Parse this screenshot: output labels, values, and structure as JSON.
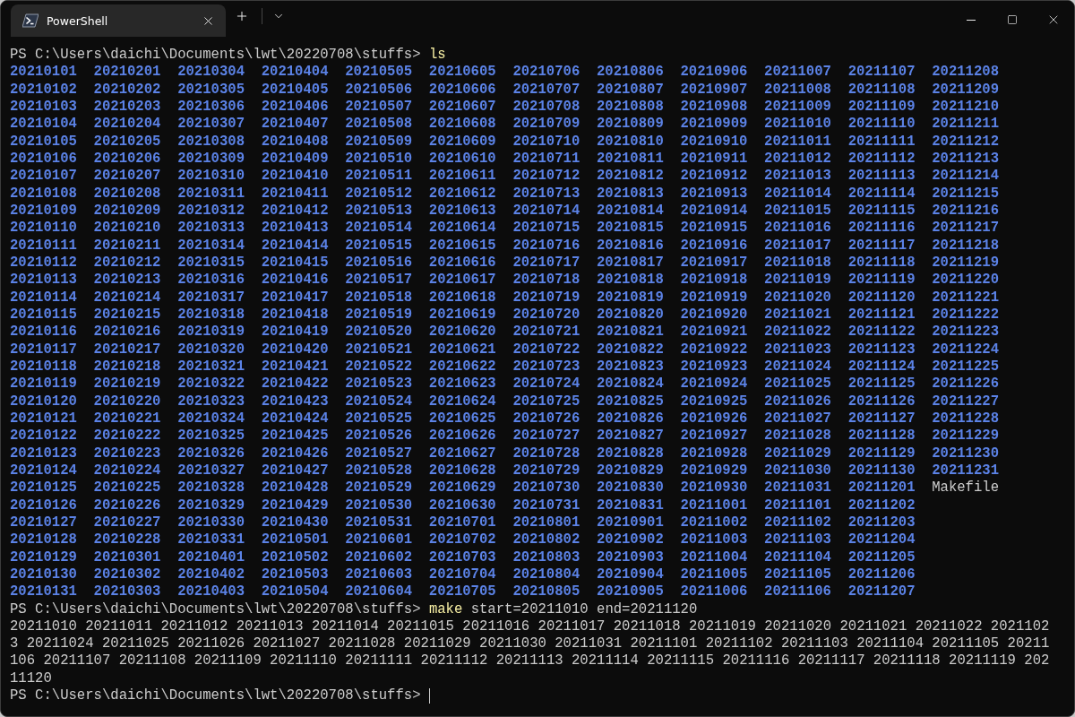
{
  "window": {
    "tab_title": "PowerShell"
  },
  "terminal": {
    "blocks": [
      {
        "kind": "command",
        "prompt": "PS C:\\Users\\daichi\\Documents\\lwt\\20220708\\stuffs>",
        "command": "ls",
        "cursor": false
      },
      {
        "kind": "listing",
        "rows": [
          [
            {
              "name": "20210101",
              "kind": "dir"
            },
            {
              "name": "20210201",
              "kind": "dir"
            },
            {
              "name": "20210304",
              "kind": "dir"
            },
            {
              "name": "20210404",
              "kind": "dir"
            },
            {
              "name": "20210505",
              "kind": "dir"
            },
            {
              "name": "20210605",
              "kind": "dir"
            },
            {
              "name": "20210706",
              "kind": "dir"
            },
            {
              "name": "20210806",
              "kind": "dir"
            },
            {
              "name": "20210906",
              "kind": "dir"
            },
            {
              "name": "20211007",
              "kind": "dir"
            },
            {
              "name": "20211107",
              "kind": "dir"
            },
            {
              "name": "20211208",
              "kind": "dir"
            }
          ],
          [
            {
              "name": "20210102",
              "kind": "dir"
            },
            {
              "name": "20210202",
              "kind": "dir"
            },
            {
              "name": "20210305",
              "kind": "dir"
            },
            {
              "name": "20210405",
              "kind": "dir"
            },
            {
              "name": "20210506",
              "kind": "dir"
            },
            {
              "name": "20210606",
              "kind": "dir"
            },
            {
              "name": "20210707",
              "kind": "dir"
            },
            {
              "name": "20210807",
              "kind": "dir"
            },
            {
              "name": "20210907",
              "kind": "dir"
            },
            {
              "name": "20211008",
              "kind": "dir"
            },
            {
              "name": "20211108",
              "kind": "dir"
            },
            {
              "name": "20211209",
              "kind": "dir"
            }
          ],
          [
            {
              "name": "20210103",
              "kind": "dir"
            },
            {
              "name": "20210203",
              "kind": "dir"
            },
            {
              "name": "20210306",
              "kind": "dir"
            },
            {
              "name": "20210406",
              "kind": "dir"
            },
            {
              "name": "20210507",
              "kind": "dir"
            },
            {
              "name": "20210607",
              "kind": "dir"
            },
            {
              "name": "20210708",
              "kind": "dir"
            },
            {
              "name": "20210808",
              "kind": "dir"
            },
            {
              "name": "20210908",
              "kind": "dir"
            },
            {
              "name": "20211009",
              "kind": "dir"
            },
            {
              "name": "20211109",
              "kind": "dir"
            },
            {
              "name": "20211210",
              "kind": "dir"
            }
          ],
          [
            {
              "name": "20210104",
              "kind": "dir"
            },
            {
              "name": "20210204",
              "kind": "dir"
            },
            {
              "name": "20210307",
              "kind": "dir"
            },
            {
              "name": "20210407",
              "kind": "dir"
            },
            {
              "name": "20210508",
              "kind": "dir"
            },
            {
              "name": "20210608",
              "kind": "dir"
            },
            {
              "name": "20210709",
              "kind": "dir"
            },
            {
              "name": "20210809",
              "kind": "dir"
            },
            {
              "name": "20210909",
              "kind": "dir"
            },
            {
              "name": "20211010",
              "kind": "dir"
            },
            {
              "name": "20211110",
              "kind": "dir"
            },
            {
              "name": "20211211",
              "kind": "dir"
            }
          ],
          [
            {
              "name": "20210105",
              "kind": "dir"
            },
            {
              "name": "20210205",
              "kind": "dir"
            },
            {
              "name": "20210308",
              "kind": "dir"
            },
            {
              "name": "20210408",
              "kind": "dir"
            },
            {
              "name": "20210509",
              "kind": "dir"
            },
            {
              "name": "20210609",
              "kind": "dir"
            },
            {
              "name": "20210710",
              "kind": "dir"
            },
            {
              "name": "20210810",
              "kind": "dir"
            },
            {
              "name": "20210910",
              "kind": "dir"
            },
            {
              "name": "20211011",
              "kind": "dir"
            },
            {
              "name": "20211111",
              "kind": "dir"
            },
            {
              "name": "20211212",
              "kind": "dir"
            }
          ],
          [
            {
              "name": "20210106",
              "kind": "dir"
            },
            {
              "name": "20210206",
              "kind": "dir"
            },
            {
              "name": "20210309",
              "kind": "dir"
            },
            {
              "name": "20210409",
              "kind": "dir"
            },
            {
              "name": "20210510",
              "kind": "dir"
            },
            {
              "name": "20210610",
              "kind": "dir"
            },
            {
              "name": "20210711",
              "kind": "dir"
            },
            {
              "name": "20210811",
              "kind": "dir"
            },
            {
              "name": "20210911",
              "kind": "dir"
            },
            {
              "name": "20211012",
              "kind": "dir"
            },
            {
              "name": "20211112",
              "kind": "dir"
            },
            {
              "name": "20211213",
              "kind": "dir"
            }
          ],
          [
            {
              "name": "20210107",
              "kind": "dir"
            },
            {
              "name": "20210207",
              "kind": "dir"
            },
            {
              "name": "20210310",
              "kind": "dir"
            },
            {
              "name": "20210410",
              "kind": "dir"
            },
            {
              "name": "20210511",
              "kind": "dir"
            },
            {
              "name": "20210611",
              "kind": "dir"
            },
            {
              "name": "20210712",
              "kind": "dir"
            },
            {
              "name": "20210812",
              "kind": "dir"
            },
            {
              "name": "20210912",
              "kind": "dir"
            },
            {
              "name": "20211013",
              "kind": "dir"
            },
            {
              "name": "20211113",
              "kind": "dir"
            },
            {
              "name": "20211214",
              "kind": "dir"
            }
          ],
          [
            {
              "name": "20210108",
              "kind": "dir"
            },
            {
              "name": "20210208",
              "kind": "dir"
            },
            {
              "name": "20210311",
              "kind": "dir"
            },
            {
              "name": "20210411",
              "kind": "dir"
            },
            {
              "name": "20210512",
              "kind": "dir"
            },
            {
              "name": "20210612",
              "kind": "dir"
            },
            {
              "name": "20210713",
              "kind": "dir"
            },
            {
              "name": "20210813",
              "kind": "dir"
            },
            {
              "name": "20210913",
              "kind": "dir"
            },
            {
              "name": "20211014",
              "kind": "dir"
            },
            {
              "name": "20211114",
              "kind": "dir"
            },
            {
              "name": "20211215",
              "kind": "dir"
            }
          ],
          [
            {
              "name": "20210109",
              "kind": "dir"
            },
            {
              "name": "20210209",
              "kind": "dir"
            },
            {
              "name": "20210312",
              "kind": "dir"
            },
            {
              "name": "20210412",
              "kind": "dir"
            },
            {
              "name": "20210513",
              "kind": "dir"
            },
            {
              "name": "20210613",
              "kind": "dir"
            },
            {
              "name": "20210714",
              "kind": "dir"
            },
            {
              "name": "20210814",
              "kind": "dir"
            },
            {
              "name": "20210914",
              "kind": "dir"
            },
            {
              "name": "20211015",
              "kind": "dir"
            },
            {
              "name": "20211115",
              "kind": "dir"
            },
            {
              "name": "20211216",
              "kind": "dir"
            }
          ],
          [
            {
              "name": "20210110",
              "kind": "dir"
            },
            {
              "name": "20210210",
              "kind": "dir"
            },
            {
              "name": "20210313",
              "kind": "dir"
            },
            {
              "name": "20210413",
              "kind": "dir"
            },
            {
              "name": "20210514",
              "kind": "dir"
            },
            {
              "name": "20210614",
              "kind": "dir"
            },
            {
              "name": "20210715",
              "kind": "dir"
            },
            {
              "name": "20210815",
              "kind": "dir"
            },
            {
              "name": "20210915",
              "kind": "dir"
            },
            {
              "name": "20211016",
              "kind": "dir"
            },
            {
              "name": "20211116",
              "kind": "dir"
            },
            {
              "name": "20211217",
              "kind": "dir"
            }
          ],
          [
            {
              "name": "20210111",
              "kind": "dir"
            },
            {
              "name": "20210211",
              "kind": "dir"
            },
            {
              "name": "20210314",
              "kind": "dir"
            },
            {
              "name": "20210414",
              "kind": "dir"
            },
            {
              "name": "20210515",
              "kind": "dir"
            },
            {
              "name": "20210615",
              "kind": "dir"
            },
            {
              "name": "20210716",
              "kind": "dir"
            },
            {
              "name": "20210816",
              "kind": "dir"
            },
            {
              "name": "20210916",
              "kind": "dir"
            },
            {
              "name": "20211017",
              "kind": "dir"
            },
            {
              "name": "20211117",
              "kind": "dir"
            },
            {
              "name": "20211218",
              "kind": "dir"
            }
          ],
          [
            {
              "name": "20210112",
              "kind": "dir"
            },
            {
              "name": "20210212",
              "kind": "dir"
            },
            {
              "name": "20210315",
              "kind": "dir"
            },
            {
              "name": "20210415",
              "kind": "dir"
            },
            {
              "name": "20210516",
              "kind": "dir"
            },
            {
              "name": "20210616",
              "kind": "dir"
            },
            {
              "name": "20210717",
              "kind": "dir"
            },
            {
              "name": "20210817",
              "kind": "dir"
            },
            {
              "name": "20210917",
              "kind": "dir"
            },
            {
              "name": "20211018",
              "kind": "dir"
            },
            {
              "name": "20211118",
              "kind": "dir"
            },
            {
              "name": "20211219",
              "kind": "dir"
            }
          ],
          [
            {
              "name": "20210113",
              "kind": "dir"
            },
            {
              "name": "20210213",
              "kind": "dir"
            },
            {
              "name": "20210316",
              "kind": "dir"
            },
            {
              "name": "20210416",
              "kind": "dir"
            },
            {
              "name": "20210517",
              "kind": "dir"
            },
            {
              "name": "20210617",
              "kind": "dir"
            },
            {
              "name": "20210718",
              "kind": "dir"
            },
            {
              "name": "20210818",
              "kind": "dir"
            },
            {
              "name": "20210918",
              "kind": "dir"
            },
            {
              "name": "20211019",
              "kind": "dir"
            },
            {
              "name": "20211119",
              "kind": "dir"
            },
            {
              "name": "20211220",
              "kind": "dir"
            }
          ],
          [
            {
              "name": "20210114",
              "kind": "dir"
            },
            {
              "name": "20210214",
              "kind": "dir"
            },
            {
              "name": "20210317",
              "kind": "dir"
            },
            {
              "name": "20210417",
              "kind": "dir"
            },
            {
              "name": "20210518",
              "kind": "dir"
            },
            {
              "name": "20210618",
              "kind": "dir"
            },
            {
              "name": "20210719",
              "kind": "dir"
            },
            {
              "name": "20210819",
              "kind": "dir"
            },
            {
              "name": "20210919",
              "kind": "dir"
            },
            {
              "name": "20211020",
              "kind": "dir"
            },
            {
              "name": "20211120",
              "kind": "dir"
            },
            {
              "name": "20211221",
              "kind": "dir"
            }
          ],
          [
            {
              "name": "20210115",
              "kind": "dir"
            },
            {
              "name": "20210215",
              "kind": "dir"
            },
            {
              "name": "20210318",
              "kind": "dir"
            },
            {
              "name": "20210418",
              "kind": "dir"
            },
            {
              "name": "20210519",
              "kind": "dir"
            },
            {
              "name": "20210619",
              "kind": "dir"
            },
            {
              "name": "20210720",
              "kind": "dir"
            },
            {
              "name": "20210820",
              "kind": "dir"
            },
            {
              "name": "20210920",
              "kind": "dir"
            },
            {
              "name": "20211021",
              "kind": "dir"
            },
            {
              "name": "20211121",
              "kind": "dir"
            },
            {
              "name": "20211222",
              "kind": "dir"
            }
          ],
          [
            {
              "name": "20210116",
              "kind": "dir"
            },
            {
              "name": "20210216",
              "kind": "dir"
            },
            {
              "name": "20210319",
              "kind": "dir"
            },
            {
              "name": "20210419",
              "kind": "dir"
            },
            {
              "name": "20210520",
              "kind": "dir"
            },
            {
              "name": "20210620",
              "kind": "dir"
            },
            {
              "name": "20210721",
              "kind": "dir"
            },
            {
              "name": "20210821",
              "kind": "dir"
            },
            {
              "name": "20210921",
              "kind": "dir"
            },
            {
              "name": "20211022",
              "kind": "dir"
            },
            {
              "name": "20211122",
              "kind": "dir"
            },
            {
              "name": "20211223",
              "kind": "dir"
            }
          ],
          [
            {
              "name": "20210117",
              "kind": "dir"
            },
            {
              "name": "20210217",
              "kind": "dir"
            },
            {
              "name": "20210320",
              "kind": "dir"
            },
            {
              "name": "20210420",
              "kind": "dir"
            },
            {
              "name": "20210521",
              "kind": "dir"
            },
            {
              "name": "20210621",
              "kind": "dir"
            },
            {
              "name": "20210722",
              "kind": "dir"
            },
            {
              "name": "20210822",
              "kind": "dir"
            },
            {
              "name": "20210922",
              "kind": "dir"
            },
            {
              "name": "20211023",
              "kind": "dir"
            },
            {
              "name": "20211123",
              "kind": "dir"
            },
            {
              "name": "20211224",
              "kind": "dir"
            }
          ],
          [
            {
              "name": "20210118",
              "kind": "dir"
            },
            {
              "name": "20210218",
              "kind": "dir"
            },
            {
              "name": "20210321",
              "kind": "dir"
            },
            {
              "name": "20210421",
              "kind": "dir"
            },
            {
              "name": "20210522",
              "kind": "dir"
            },
            {
              "name": "20210622",
              "kind": "dir"
            },
            {
              "name": "20210723",
              "kind": "dir"
            },
            {
              "name": "20210823",
              "kind": "dir"
            },
            {
              "name": "20210923",
              "kind": "dir"
            },
            {
              "name": "20211024",
              "kind": "dir"
            },
            {
              "name": "20211124",
              "kind": "dir"
            },
            {
              "name": "20211225",
              "kind": "dir"
            }
          ],
          [
            {
              "name": "20210119",
              "kind": "dir"
            },
            {
              "name": "20210219",
              "kind": "dir"
            },
            {
              "name": "20210322",
              "kind": "dir"
            },
            {
              "name": "20210422",
              "kind": "dir"
            },
            {
              "name": "20210523",
              "kind": "dir"
            },
            {
              "name": "20210623",
              "kind": "dir"
            },
            {
              "name": "20210724",
              "kind": "dir"
            },
            {
              "name": "20210824",
              "kind": "dir"
            },
            {
              "name": "20210924",
              "kind": "dir"
            },
            {
              "name": "20211025",
              "kind": "dir"
            },
            {
              "name": "20211125",
              "kind": "dir"
            },
            {
              "name": "20211226",
              "kind": "dir"
            }
          ],
          [
            {
              "name": "20210120",
              "kind": "dir"
            },
            {
              "name": "20210220",
              "kind": "dir"
            },
            {
              "name": "20210323",
              "kind": "dir"
            },
            {
              "name": "20210423",
              "kind": "dir"
            },
            {
              "name": "20210524",
              "kind": "dir"
            },
            {
              "name": "20210624",
              "kind": "dir"
            },
            {
              "name": "20210725",
              "kind": "dir"
            },
            {
              "name": "20210825",
              "kind": "dir"
            },
            {
              "name": "20210925",
              "kind": "dir"
            },
            {
              "name": "20211026",
              "kind": "dir"
            },
            {
              "name": "20211126",
              "kind": "dir"
            },
            {
              "name": "20211227",
              "kind": "dir"
            }
          ],
          [
            {
              "name": "20210121",
              "kind": "dir"
            },
            {
              "name": "20210221",
              "kind": "dir"
            },
            {
              "name": "20210324",
              "kind": "dir"
            },
            {
              "name": "20210424",
              "kind": "dir"
            },
            {
              "name": "20210525",
              "kind": "dir"
            },
            {
              "name": "20210625",
              "kind": "dir"
            },
            {
              "name": "20210726",
              "kind": "dir"
            },
            {
              "name": "20210826",
              "kind": "dir"
            },
            {
              "name": "20210926",
              "kind": "dir"
            },
            {
              "name": "20211027",
              "kind": "dir"
            },
            {
              "name": "20211127",
              "kind": "dir"
            },
            {
              "name": "20211228",
              "kind": "dir"
            }
          ],
          [
            {
              "name": "20210122",
              "kind": "dir"
            },
            {
              "name": "20210222",
              "kind": "dir"
            },
            {
              "name": "20210325",
              "kind": "dir"
            },
            {
              "name": "20210425",
              "kind": "dir"
            },
            {
              "name": "20210526",
              "kind": "dir"
            },
            {
              "name": "20210626",
              "kind": "dir"
            },
            {
              "name": "20210727",
              "kind": "dir"
            },
            {
              "name": "20210827",
              "kind": "dir"
            },
            {
              "name": "20210927",
              "kind": "dir"
            },
            {
              "name": "20211028",
              "kind": "dir"
            },
            {
              "name": "20211128",
              "kind": "dir"
            },
            {
              "name": "20211229",
              "kind": "dir"
            }
          ],
          [
            {
              "name": "20210123",
              "kind": "dir"
            },
            {
              "name": "20210223",
              "kind": "dir"
            },
            {
              "name": "20210326",
              "kind": "dir"
            },
            {
              "name": "20210426",
              "kind": "dir"
            },
            {
              "name": "20210527",
              "kind": "dir"
            },
            {
              "name": "20210627",
              "kind": "dir"
            },
            {
              "name": "20210728",
              "kind": "dir"
            },
            {
              "name": "20210828",
              "kind": "dir"
            },
            {
              "name": "20210928",
              "kind": "dir"
            },
            {
              "name": "20211029",
              "kind": "dir"
            },
            {
              "name": "20211129",
              "kind": "dir"
            },
            {
              "name": "20211230",
              "kind": "dir"
            }
          ],
          [
            {
              "name": "20210124",
              "kind": "dir"
            },
            {
              "name": "20210224",
              "kind": "dir"
            },
            {
              "name": "20210327",
              "kind": "dir"
            },
            {
              "name": "20210427",
              "kind": "dir"
            },
            {
              "name": "20210528",
              "kind": "dir"
            },
            {
              "name": "20210628",
              "kind": "dir"
            },
            {
              "name": "20210729",
              "kind": "dir"
            },
            {
              "name": "20210829",
              "kind": "dir"
            },
            {
              "name": "20210929",
              "kind": "dir"
            },
            {
              "name": "20211030",
              "kind": "dir"
            },
            {
              "name": "20211130",
              "kind": "dir"
            },
            {
              "name": "20211231",
              "kind": "dir"
            }
          ],
          [
            {
              "name": "20210125",
              "kind": "dir"
            },
            {
              "name": "20210225",
              "kind": "dir"
            },
            {
              "name": "20210328",
              "kind": "dir"
            },
            {
              "name": "20210428",
              "kind": "dir"
            },
            {
              "name": "20210529",
              "kind": "dir"
            },
            {
              "name": "20210629",
              "kind": "dir"
            },
            {
              "name": "20210730",
              "kind": "dir"
            },
            {
              "name": "20210830",
              "kind": "dir"
            },
            {
              "name": "20210930",
              "kind": "dir"
            },
            {
              "name": "20211031",
              "kind": "dir"
            },
            {
              "name": "20211201",
              "kind": "dir"
            },
            {
              "name": "Makefile",
              "kind": "file"
            }
          ],
          [
            {
              "name": "20210126",
              "kind": "dir"
            },
            {
              "name": "20210226",
              "kind": "dir"
            },
            {
              "name": "20210329",
              "kind": "dir"
            },
            {
              "name": "20210429",
              "kind": "dir"
            },
            {
              "name": "20210530",
              "kind": "dir"
            },
            {
              "name": "20210630",
              "kind": "dir"
            },
            {
              "name": "20210731",
              "kind": "dir"
            },
            {
              "name": "20210831",
              "kind": "dir"
            },
            {
              "name": "20211001",
              "kind": "dir"
            },
            {
              "name": "20211101",
              "kind": "dir"
            },
            {
              "name": "20211202",
              "kind": "dir"
            }
          ],
          [
            {
              "name": "20210127",
              "kind": "dir"
            },
            {
              "name": "20210227",
              "kind": "dir"
            },
            {
              "name": "20210330",
              "kind": "dir"
            },
            {
              "name": "20210430",
              "kind": "dir"
            },
            {
              "name": "20210531",
              "kind": "dir"
            },
            {
              "name": "20210701",
              "kind": "dir"
            },
            {
              "name": "20210801",
              "kind": "dir"
            },
            {
              "name": "20210901",
              "kind": "dir"
            },
            {
              "name": "20211002",
              "kind": "dir"
            },
            {
              "name": "20211102",
              "kind": "dir"
            },
            {
              "name": "20211203",
              "kind": "dir"
            }
          ],
          [
            {
              "name": "20210128",
              "kind": "dir"
            },
            {
              "name": "20210228",
              "kind": "dir"
            },
            {
              "name": "20210331",
              "kind": "dir"
            },
            {
              "name": "20210501",
              "kind": "dir"
            },
            {
              "name": "20210601",
              "kind": "dir"
            },
            {
              "name": "20210702",
              "kind": "dir"
            },
            {
              "name": "20210802",
              "kind": "dir"
            },
            {
              "name": "20210902",
              "kind": "dir"
            },
            {
              "name": "20211003",
              "kind": "dir"
            },
            {
              "name": "20211103",
              "kind": "dir"
            },
            {
              "name": "20211204",
              "kind": "dir"
            }
          ],
          [
            {
              "name": "20210129",
              "kind": "dir"
            },
            {
              "name": "20210301",
              "kind": "dir"
            },
            {
              "name": "20210401",
              "kind": "dir"
            },
            {
              "name": "20210502",
              "kind": "dir"
            },
            {
              "name": "20210602",
              "kind": "dir"
            },
            {
              "name": "20210703",
              "kind": "dir"
            },
            {
              "name": "20210803",
              "kind": "dir"
            },
            {
              "name": "20210903",
              "kind": "dir"
            },
            {
              "name": "20211004",
              "kind": "dir"
            },
            {
              "name": "20211104",
              "kind": "dir"
            },
            {
              "name": "20211205",
              "kind": "dir"
            }
          ],
          [
            {
              "name": "20210130",
              "kind": "dir"
            },
            {
              "name": "20210302",
              "kind": "dir"
            },
            {
              "name": "20210402",
              "kind": "dir"
            },
            {
              "name": "20210503",
              "kind": "dir"
            },
            {
              "name": "20210603",
              "kind": "dir"
            },
            {
              "name": "20210704",
              "kind": "dir"
            },
            {
              "name": "20210804",
              "kind": "dir"
            },
            {
              "name": "20210904",
              "kind": "dir"
            },
            {
              "name": "20211005",
              "kind": "dir"
            },
            {
              "name": "20211105",
              "kind": "dir"
            },
            {
              "name": "20211206",
              "kind": "dir"
            }
          ],
          [
            {
              "name": "20210131",
              "kind": "dir"
            },
            {
              "name": "20210303",
              "kind": "dir"
            },
            {
              "name": "20210403",
              "kind": "dir"
            },
            {
              "name": "20210504",
              "kind": "dir"
            },
            {
              "name": "20210604",
              "kind": "dir"
            },
            {
              "name": "20210705",
              "kind": "dir"
            },
            {
              "name": "20210805",
              "kind": "dir"
            },
            {
              "name": "20210905",
              "kind": "dir"
            },
            {
              "name": "20211006",
              "kind": "dir"
            },
            {
              "name": "20211106",
              "kind": "dir"
            },
            {
              "name": "20211207",
              "kind": "dir"
            }
          ]
        ]
      },
      {
        "kind": "command",
        "prompt": "PS C:\\Users\\daichi\\Documents\\lwt\\20220708\\stuffs>",
        "command": "make",
        "args": "start=20211010 end=20211120",
        "cursor": false
      },
      {
        "kind": "output",
        "lines": [
          "20211010 20211011 20211012 20211013 20211014 20211015 20211016 20211017 20211018 20211019 20211020 20211021 20211022 2021102",
          "3 20211024 20211025 20211026 20211027 20211028 20211029 20211030 20211031 20211101 20211102 20211103 20211104 20211105 20211",
          "106 20211107 20211108 20211109 20211110 20211111 20211112 20211113 20211114 20211115 20211116 20211117 20211118 20211119 202",
          "11120"
        ]
      },
      {
        "kind": "command",
        "prompt": "PS C:\\Users\\daichi\\Documents\\lwt\\20220708\\stuffs>",
        "cursor": true
      }
    ]
  }
}
